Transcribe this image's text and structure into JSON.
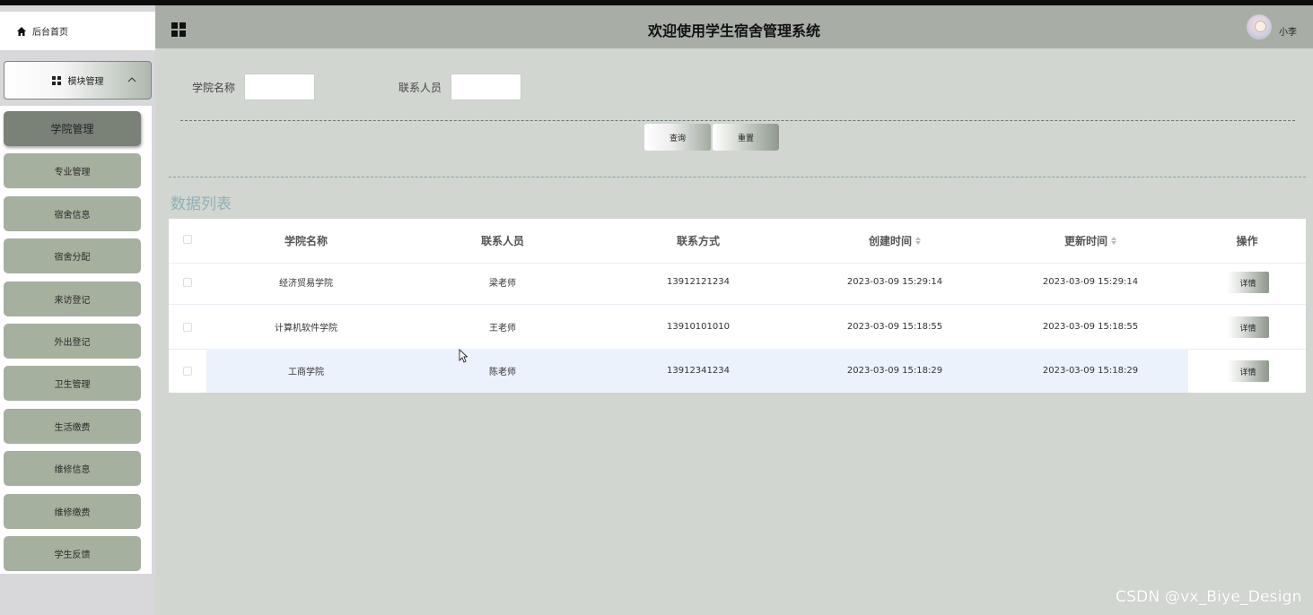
{
  "sidebar": {
    "home_label": "后台首页",
    "module_label": "模块管理",
    "items": [
      {
        "label": "学院管理",
        "active": true
      },
      {
        "label": "专业管理"
      },
      {
        "label": "宿舍信息"
      },
      {
        "label": "宿舍分配"
      },
      {
        "label": "来访登记"
      },
      {
        "label": "外出登记"
      },
      {
        "label": "卫生管理"
      },
      {
        "label": "生活缴费"
      },
      {
        "label": "维修信息"
      },
      {
        "label": "维修缴费"
      },
      {
        "label": "学生反馈"
      }
    ]
  },
  "header": {
    "title": "欢迎使用学生宿舍管理系统",
    "username": "小李"
  },
  "search": {
    "college_label": "学院名称",
    "college_value": "",
    "contact_label": "联系人员",
    "contact_value": "",
    "query_label": "查询",
    "reset_label": "重置"
  },
  "list": {
    "title": "数据列表",
    "columns": [
      "学院名称",
      "联系人员",
      "联系方式",
      "创建时间",
      "更新时间",
      "操作"
    ],
    "rows": [
      {
        "college": "经济贸易学院",
        "contact": "梁老师",
        "phone": "13912121234",
        "created": "2023-03-09 15:29:14",
        "updated": "2023-03-09 15:29:14",
        "action": "详情"
      },
      {
        "college": "计算机软件学院",
        "contact": "王老师",
        "phone": "13910101010",
        "created": "2023-03-09 15:18:55",
        "updated": "2023-03-09 15:18:55",
        "action": "详情"
      },
      {
        "college": "工商学院",
        "contact": "陈老师",
        "phone": "13912341234",
        "created": "2023-03-09 15:18:29",
        "updated": "2023-03-09 15:18:29",
        "action": "详情"
      }
    ]
  },
  "watermark": "CSDN @vx_Biye_Design",
  "colors": {
    "header_bg": "#a8aea6",
    "content_bg": "#d2d6d1",
    "menu_item_bg": "#a5b09f",
    "menu_active_bg": "#7a8278",
    "section_title": "#8fb0b6"
  }
}
